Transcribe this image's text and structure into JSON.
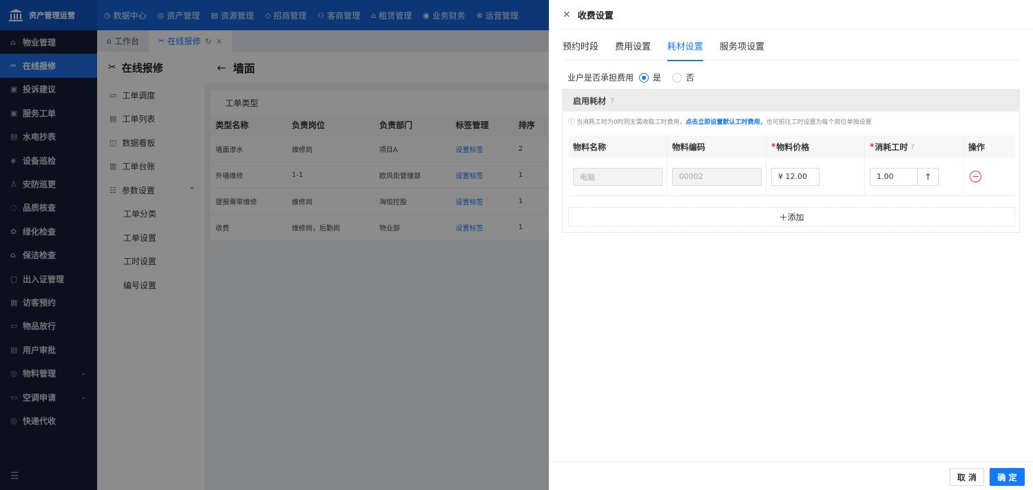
{
  "app": {
    "title": "资产管理运营"
  },
  "topnav": [
    {
      "icon": "◷",
      "label": "数据中心"
    },
    {
      "icon": "◎",
      "label": "资产管理"
    },
    {
      "icon": "▤",
      "label": "资源管理"
    },
    {
      "icon": "◇",
      "label": "招商管理"
    },
    {
      "icon": "⚇",
      "label": "客商管理"
    },
    {
      "icon": "⌂",
      "label": "租赁管理"
    },
    {
      "icon": "◉",
      "label": "业务财务"
    },
    {
      "icon": "⊗",
      "label": "运营管理"
    }
  ],
  "sidebar": {
    "items": [
      {
        "icon": "⌂",
        "label": "物业管理"
      },
      {
        "icon": "✂",
        "label": "在线报修"
      },
      {
        "icon": "▣",
        "label": "投诉建议"
      },
      {
        "icon": "▣",
        "label": "服务工单"
      },
      {
        "icon": "▤",
        "label": "水电抄表"
      },
      {
        "icon": "◈",
        "label": "设备巡检"
      },
      {
        "icon": "♙",
        "label": "安防巡更"
      },
      {
        "icon": "◌",
        "label": "品质核查"
      },
      {
        "icon": "✿",
        "label": "绿化检查"
      },
      {
        "icon": "⌂",
        "label": "保洁检查"
      },
      {
        "icon": "▢",
        "label": "出入证管理"
      },
      {
        "icon": "▦",
        "label": "访客预约"
      },
      {
        "icon": "▭",
        "label": "物品放行"
      },
      {
        "icon": "▤",
        "label": "用户审批"
      },
      {
        "icon": "◎",
        "label": "物料管理",
        "chevron": "⌄"
      },
      {
        "icon": "▭",
        "label": "空调申请",
        "chevron": "⌄"
      },
      {
        "icon": "◎",
        "label": "快递代收"
      }
    ],
    "bottom_icon": "☰"
  },
  "tabs": [
    {
      "icon": "⌂",
      "label": "工作台"
    },
    {
      "icon": "✂",
      "label": "在线报修",
      "refresh": "↻",
      "close": "×"
    }
  ],
  "subside": {
    "title": "在线报修",
    "title_icon": "✂",
    "items": [
      {
        "icon": "▭",
        "label": "工单调度"
      },
      {
        "icon": "▤",
        "label": "工单列表"
      },
      {
        "icon": "◫",
        "label": "数据看板"
      },
      {
        "icon": "▥",
        "label": "工单台账"
      },
      {
        "icon": "☷",
        "label": "参数设置",
        "caret": "^"
      }
    ],
    "children": [
      "工单分类",
      "工单设置",
      "工时设置",
      "编号设置"
    ]
  },
  "main": {
    "back": "←",
    "title": "墙面",
    "panel_title": "工单类型",
    "columns": [
      "类型名称",
      "负责岗位",
      "负责部门",
      "标签管理",
      "排序"
    ],
    "rows": [
      [
        "墙面渗水",
        "维修岗",
        "项目A",
        "设置标签",
        "2"
      ],
      [
        "外墙维修",
        "1-1",
        "欧风街管理部",
        "设置标签",
        "1"
      ],
      [
        "提报需审维修",
        "维修岗",
        "海恒控股",
        "设置标签",
        "1"
      ],
      [
        "收费",
        "维修岗，后勤岗",
        "物业部",
        "设置标签",
        "1"
      ]
    ]
  },
  "drawer": {
    "title": "收费设置",
    "close": "×",
    "tabs": [
      "预约时段",
      "费用设置",
      "耗材设置",
      "服务项设置"
    ],
    "active_tab": 2,
    "owner_pays_label": "业户是否承担费用",
    "yes": "是",
    "no": "否",
    "box_title": "启用耗材",
    "help_icon": "?",
    "note_prefix": "ⓘ 当消耗工时为0时则无需收取工时费用，",
    "note_link": "点击立即设置默认工时费用，",
    "note_suffix": "也可前往工时设置为每个岗位单独设置",
    "columns": {
      "name": "物料名称",
      "code": "物料编码",
      "price": "物料价格",
      "hours": "消耗工时",
      "action": "操作"
    },
    "row": {
      "name": "电脑",
      "code": "00002",
      "price": "¥ 12.00",
      "hours": "1.00",
      "step_icon": "↑"
    },
    "add_label": "＋添加",
    "cancel": "取 消",
    "ok": "确 定"
  }
}
